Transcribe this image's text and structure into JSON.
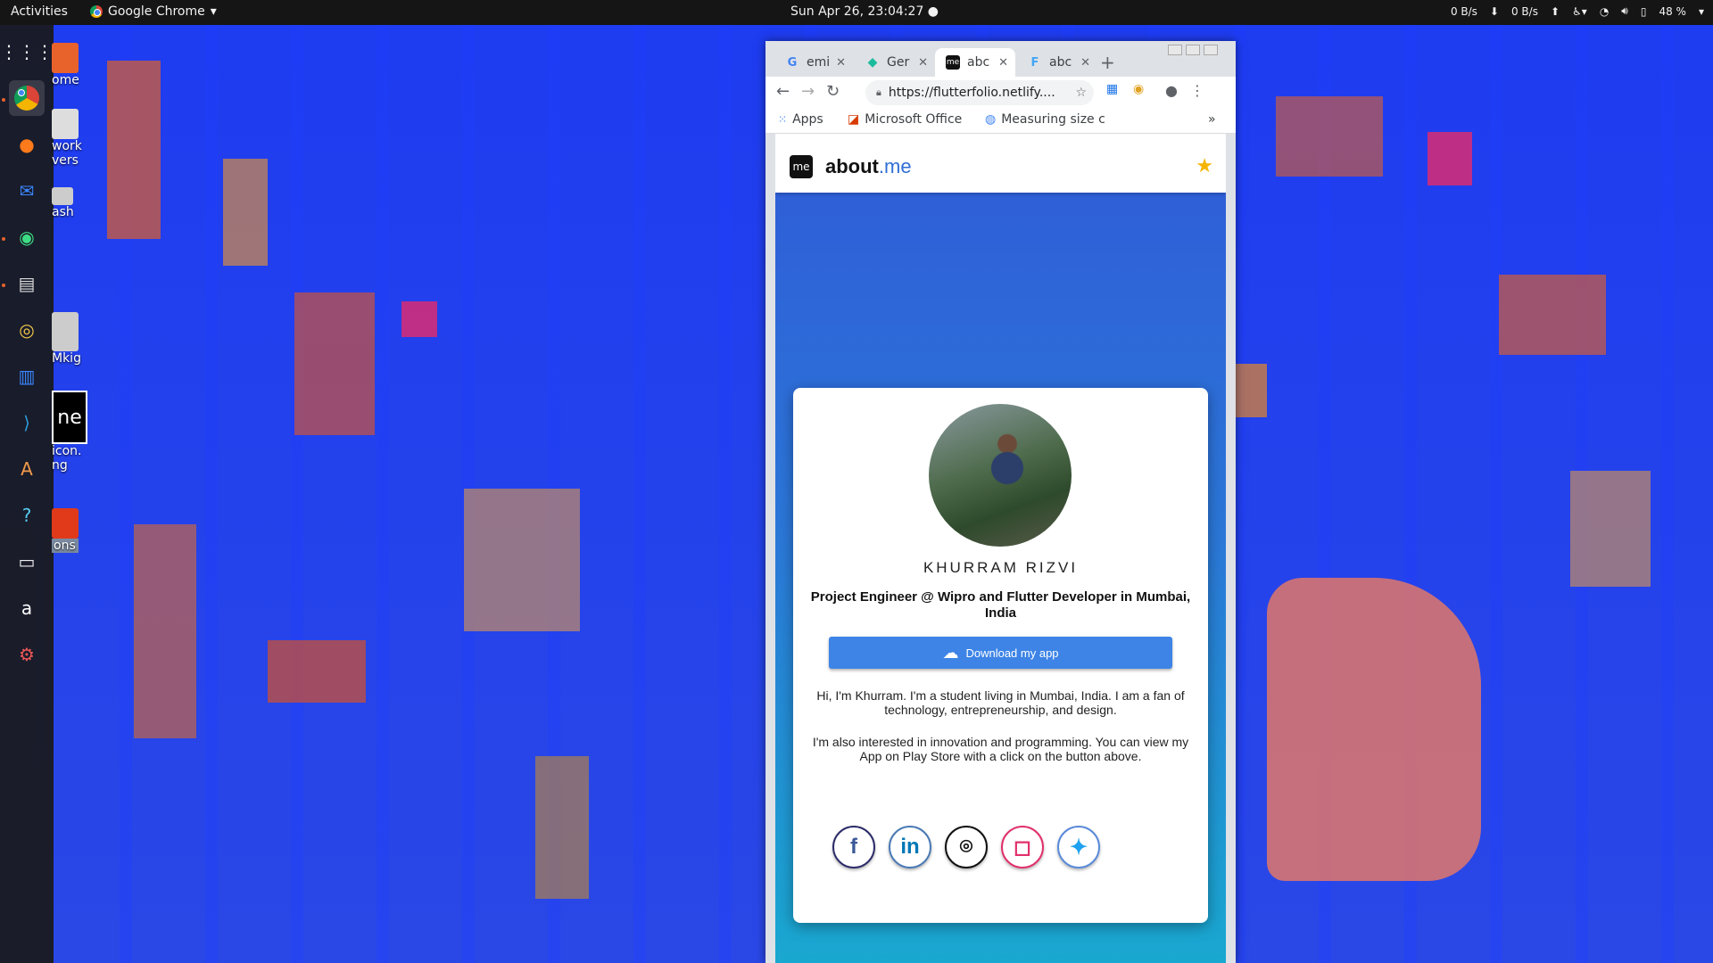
{
  "topbar": {
    "activities": "Activities",
    "app_name": "Google Chrome",
    "clock": "Sun Apr 26, 23:04:27",
    "net_down": "0 B/s",
    "net_up": "0 B/s",
    "battery": "48 %"
  },
  "dock": {
    "items": [
      "apps-grid-icon",
      "chrome-icon",
      "firefox-icon",
      "thunderbird-icon",
      "android-studio-icon",
      "files-icon",
      "rhythmbox-icon",
      "libreoffice-writer-icon",
      "vscode-icon",
      "software-center-icon",
      "help-icon",
      "terminal-icon",
      "amazon-icon",
      "settings-icon"
    ]
  },
  "desktop": {
    "icons": [
      {
        "label": "ome"
      },
      {
        "label": "work\nvers"
      },
      {
        "label": "ash"
      },
      {
        "label": "Mkig"
      },
      {
        "label": "icon.\nng"
      },
      {
        "label": "ons"
      }
    ]
  },
  "browser": {
    "tabs": [
      {
        "label": "emi",
        "favicon": "G"
      },
      {
        "label": "Ger",
        "favicon": "◆"
      },
      {
        "label": "abc",
        "favicon": "me"
      },
      {
        "label": "abc",
        "favicon": "F"
      }
    ],
    "url": "https://flutterfolio.netlify....",
    "bookmarks": [
      "Apps",
      "Microsoft Office",
      "Measuring size c"
    ],
    "more": "»"
  },
  "page": {
    "logo_box": "me",
    "logo_main": "about",
    "logo_suffix": ".me",
    "profile": {
      "name": "KHURRAM RIZVI",
      "headline": "Project Engineer @ Wipro and Flutter Developer in Mumbai, India",
      "button_label": "Download my app",
      "bio_1": "Hi, I'm Khurram. I'm a student living in Mumbai, India. I am a fan of technology, entrepreneurship, and design.",
      "bio_2": "I'm also interested in innovation and programming. You can view my App on Play Store with a click on the button above."
    },
    "social": [
      {
        "name": "facebook",
        "glyph": "f",
        "color": "#3b5998"
      },
      {
        "name": "linkedin",
        "glyph": "in",
        "color": "#0077b5"
      },
      {
        "name": "github",
        "glyph": "⌾",
        "color": "#111111"
      },
      {
        "name": "instagram",
        "glyph": "◻",
        "color": "#e1306c"
      },
      {
        "name": "twitter",
        "glyph": "✦",
        "color": "#1da1f2"
      }
    ]
  },
  "colors": {
    "accent": "#3d84e6",
    "star": "#f5b400"
  }
}
